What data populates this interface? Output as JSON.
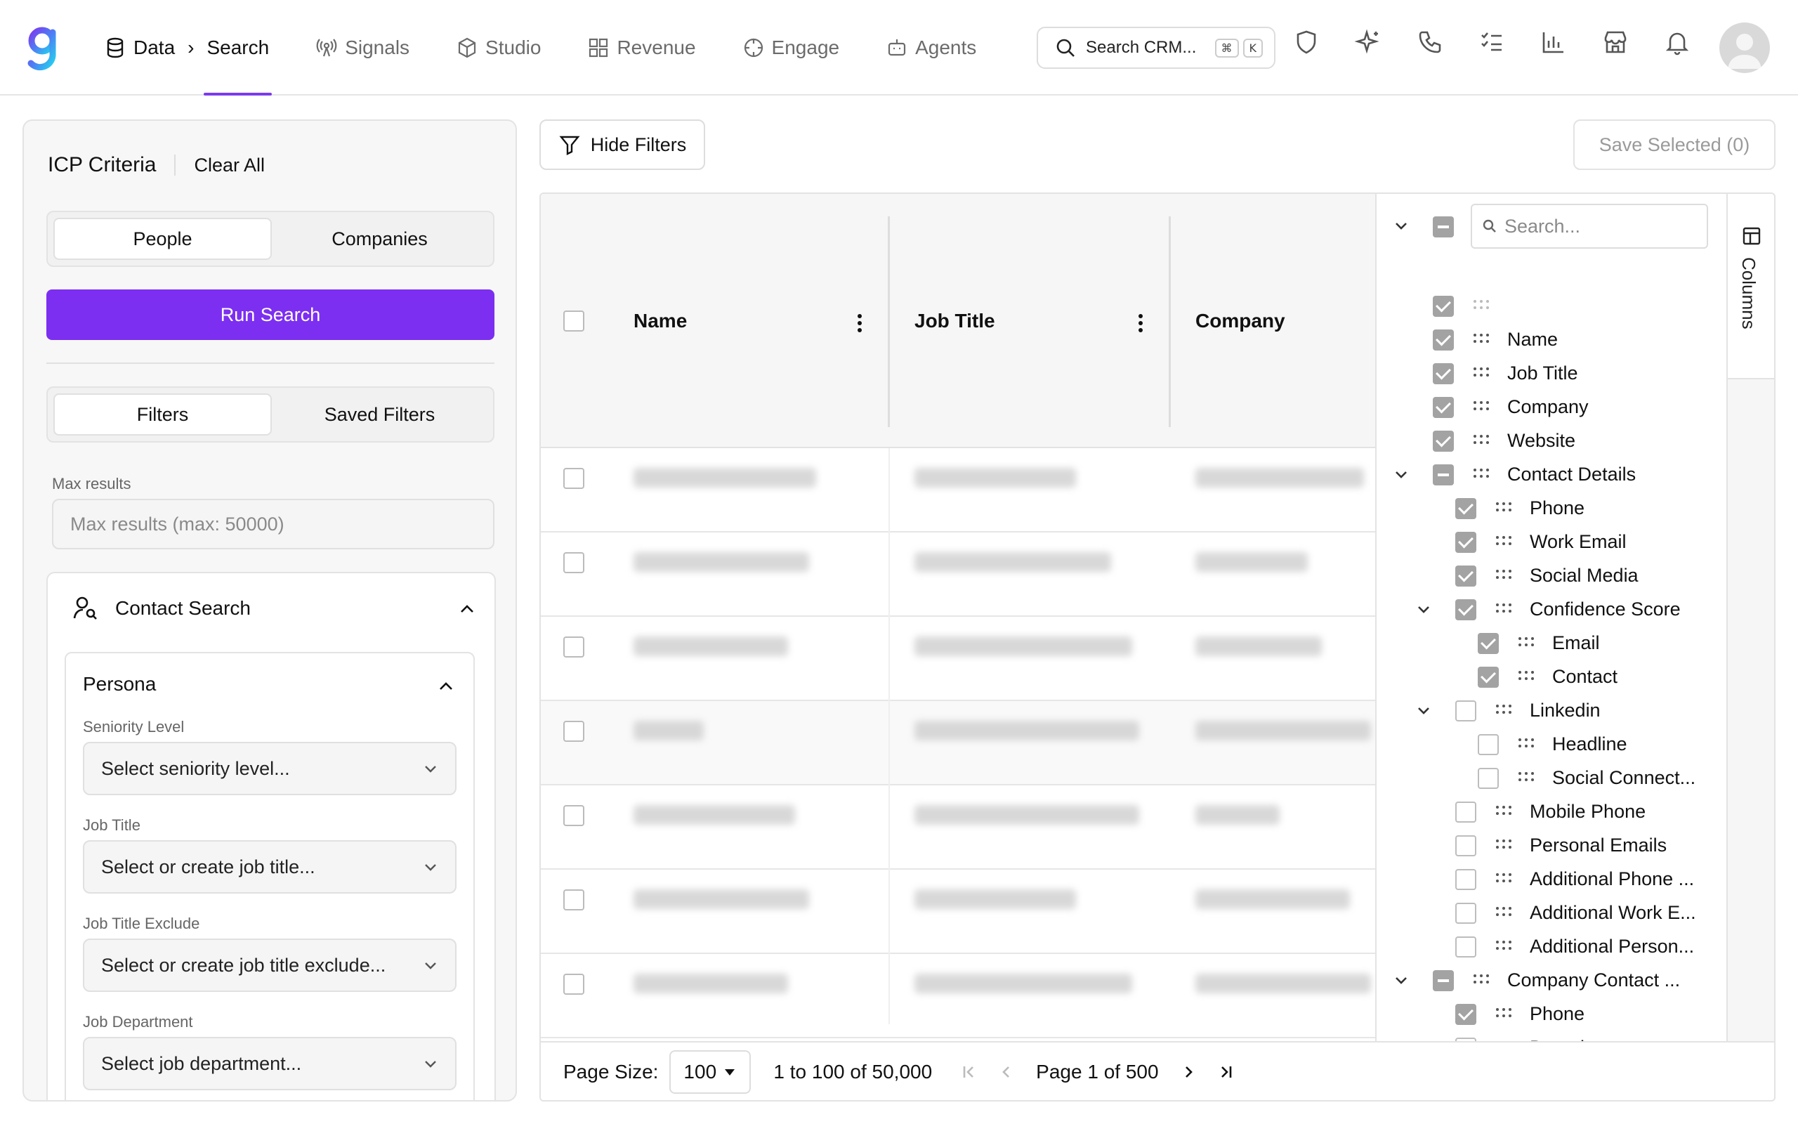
{
  "nav": {
    "breadcrumb_root": "Data",
    "breadcrumb_current": "Search",
    "items": [
      {
        "label": "Signals",
        "icon": "broadcast-icon"
      },
      {
        "label": "Studio",
        "icon": "cube-icon"
      },
      {
        "label": "Revenue",
        "icon": "grid-icon"
      },
      {
        "label": "Engage",
        "icon": "target-icon"
      },
      {
        "label": "Agents",
        "icon": "robot-icon"
      }
    ],
    "search_label": "Search CRM...",
    "search_kbd": [
      "⌘",
      "K"
    ],
    "icons": [
      "shield-icon",
      "sparkle-icon",
      "phone-icon",
      "checklist-icon",
      "bar-chart-icon",
      "store-icon",
      "bell-icon"
    ]
  },
  "left": {
    "title": "ICP Criteria",
    "clear": "Clear All",
    "type_tabs": [
      "People",
      "Companies"
    ],
    "run": "Run Search",
    "filter_tabs": [
      "Filters",
      "Saved Filters"
    ],
    "max_label": "Max results",
    "max_placeholder": "Max results (max: 50000)",
    "contact_search": "Contact Search",
    "persona": "Persona",
    "fields": [
      {
        "label": "Seniority Level",
        "placeholder": "Select seniority level..."
      },
      {
        "label": "Job Title",
        "placeholder": "Select or create job title..."
      },
      {
        "label": "Job Title Exclude",
        "placeholder": "Select or create job title exclude..."
      },
      {
        "label": "Job Department",
        "placeholder": "Select job department..."
      }
    ]
  },
  "main": {
    "hide_filters": "Hide Filters",
    "save_selected": "Save Selected (0)",
    "columns": [
      "Name",
      "Job Title",
      "Company"
    ],
    "columns_tab": "Columns",
    "column_search_placeholder": "Search...",
    "tree": [
      {
        "label": "",
        "level": 0,
        "state": "checked",
        "expander": false
      },
      {
        "label": "Name",
        "level": 0,
        "state": "checked",
        "expander": false
      },
      {
        "label": "Job Title",
        "level": 0,
        "state": "checked",
        "expander": false
      },
      {
        "label": "Company",
        "level": 0,
        "state": "checked",
        "expander": false
      },
      {
        "label": "Website",
        "level": 0,
        "state": "checked",
        "expander": false
      },
      {
        "label": "Contact Details",
        "level": 0,
        "state": "partial",
        "expander": true
      },
      {
        "label": "Phone",
        "level": 1,
        "state": "checked",
        "expander": false
      },
      {
        "label": "Work Email",
        "level": 1,
        "state": "checked",
        "expander": false
      },
      {
        "label": "Social Media",
        "level": 1,
        "state": "checked",
        "expander": false
      },
      {
        "label": "Confidence Score",
        "level": 1,
        "state": "checked",
        "expander": true
      },
      {
        "label": "Email",
        "level": 2,
        "state": "checked",
        "expander": false
      },
      {
        "label": "Contact",
        "level": 2,
        "state": "checked",
        "expander": false
      },
      {
        "label": "Linkedin",
        "level": 1,
        "state": "unchecked",
        "expander": true
      },
      {
        "label": "Headline",
        "level": 2,
        "state": "unchecked",
        "expander": false
      },
      {
        "label": "Social Connect...",
        "level": 2,
        "state": "unchecked",
        "expander": false
      },
      {
        "label": "Mobile Phone",
        "level": 1,
        "state": "unchecked",
        "expander": false
      },
      {
        "label": "Personal Emails",
        "level": 1,
        "state": "unchecked",
        "expander": false
      },
      {
        "label": "Additional Phone ...",
        "level": 1,
        "state": "unchecked",
        "expander": false
      },
      {
        "label": "Additional Work E...",
        "level": 1,
        "state": "unchecked",
        "expander": false
      },
      {
        "label": "Additional Person...",
        "level": 1,
        "state": "unchecked",
        "expander": false
      },
      {
        "label": "Company Contact ...",
        "level": 0,
        "state": "partial",
        "expander": true
      },
      {
        "label": "Phone",
        "level": 1,
        "state": "checked",
        "expander": false
      },
      {
        "label": "Domain",
        "level": 1,
        "state": "unchecked",
        "expander": false
      }
    ],
    "footer": {
      "page_size_label": "Page Size:",
      "page_size": "100",
      "range": "1 to 100 of 50,000",
      "page_label": "Page 1 of 500"
    }
  }
}
